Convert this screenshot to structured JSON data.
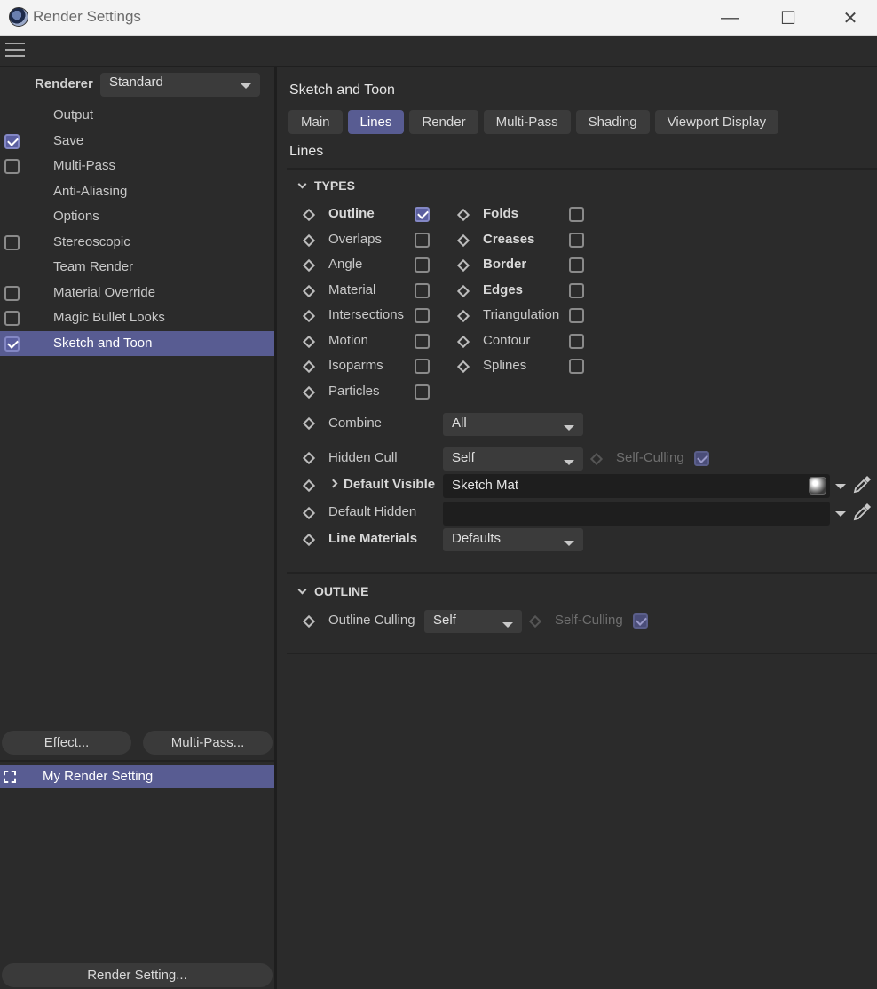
{
  "window": {
    "title": "Render Settings",
    "controls": {
      "minimize": "—",
      "maximize": "☐",
      "close": "✕"
    }
  },
  "left": {
    "renderer_label": "Renderer",
    "renderer_value": "Standard",
    "items": [
      {
        "label": "Output",
        "checkbox": null
      },
      {
        "label": "Save",
        "checkbox": true
      },
      {
        "label": "Multi-Pass",
        "checkbox": false
      },
      {
        "label": "Anti-Aliasing",
        "checkbox": null
      },
      {
        "label": "Options",
        "checkbox": null
      },
      {
        "label": "Stereoscopic",
        "checkbox": false
      },
      {
        "label": "Team Render",
        "checkbox": null
      },
      {
        "label": "Material Override",
        "checkbox": false
      },
      {
        "label": "Magic Bullet Looks",
        "checkbox": false
      },
      {
        "label": "Sketch and Toon",
        "checkbox": true,
        "selected": true
      }
    ],
    "effect_button": "Effect...",
    "multipass_button": "Multi-Pass...",
    "render_setting_item": "My Render Setting",
    "render_setting_button": "Render Setting..."
  },
  "right": {
    "title": "Sketch and Toon",
    "tabs": [
      {
        "label": "Main",
        "active": false
      },
      {
        "label": "Lines",
        "active": true
      },
      {
        "label": "Render",
        "active": false
      },
      {
        "label": "Multi-Pass",
        "active": false
      },
      {
        "label": "Shading",
        "active": false
      },
      {
        "label": "Viewport Display",
        "active": false
      }
    ],
    "subtitle": "Lines",
    "types_header": "TYPES",
    "types_left": [
      {
        "label": "Outline",
        "bold": true,
        "checked": true
      },
      {
        "label": "Overlaps",
        "bold": false,
        "checked": false
      },
      {
        "label": "Angle",
        "bold": false,
        "checked": false
      },
      {
        "label": "Material",
        "bold": false,
        "checked": false
      },
      {
        "label": "Intersections",
        "bold": false,
        "checked": false
      },
      {
        "label": "Motion",
        "bold": false,
        "checked": false
      },
      {
        "label": "Isoparms",
        "bold": false,
        "checked": false
      },
      {
        "label": "Particles",
        "bold": false,
        "checked": false
      }
    ],
    "types_right": [
      {
        "label": "Folds",
        "bold": true,
        "checked": false
      },
      {
        "label": "Creases",
        "bold": true,
        "checked": false
      },
      {
        "label": "Border",
        "bold": true,
        "checked": false
      },
      {
        "label": "Edges",
        "bold": true,
        "checked": false
      },
      {
        "label": "Triangulation",
        "bold": false,
        "checked": false
      },
      {
        "label": "Contour",
        "bold": false,
        "checked": false
      },
      {
        "label": "Splines",
        "bold": false,
        "checked": false
      }
    ],
    "combine_label": "Combine",
    "combine_value": "All",
    "hidden_cull_label": "Hidden Cull",
    "hidden_cull_value": "Self",
    "self_culling_label": "Self-Culling",
    "default_visible_label": "Default Visible",
    "default_visible_value": "Sketch Mat",
    "default_hidden_label": "Default Hidden",
    "default_hidden_value": "",
    "line_materials_label": "Line Materials",
    "line_materials_value": "Defaults",
    "outline_header": "OUTLINE",
    "outline_culling_label": "Outline Culling",
    "outline_culling_value": "Self",
    "outline_self_culling_label": "Self-Culling"
  },
  "colors": {
    "accent": "#585c92",
    "background": "#2b2b2b",
    "titlebar": "#f3f3f3"
  }
}
